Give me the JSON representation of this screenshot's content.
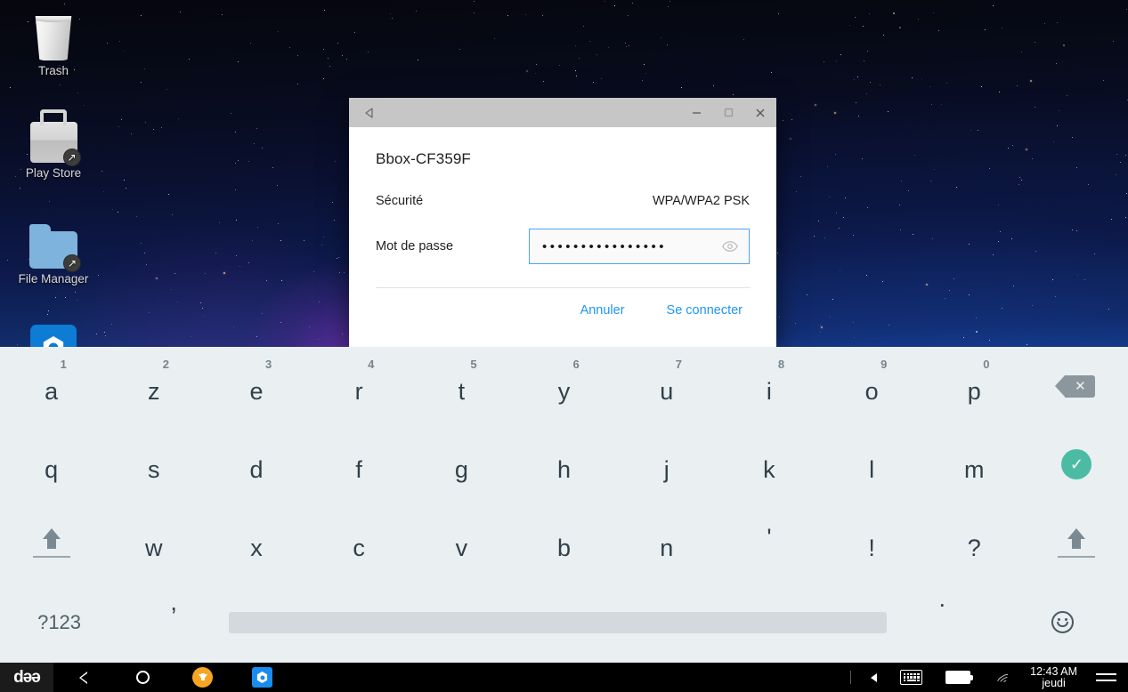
{
  "desktop": {
    "icons": [
      {
        "label": "Trash",
        "icon": "trash-icon"
      },
      {
        "label": "Play Store",
        "icon": "play-store-icon"
      },
      {
        "label": "File Manager",
        "icon": "folder-icon"
      },
      {
        "label": "",
        "icon": "settings-icon"
      }
    ]
  },
  "dialog": {
    "titlebar": {
      "back_icon": "back-triangle-icon",
      "minimize_label": "—",
      "maximize_label": "□",
      "close_label": "✕"
    },
    "ssid": "Bbox-CF359F",
    "security_label": "Sécurité",
    "security_value": "WPA/WPA2 PSK",
    "password_label": "Mot de passe",
    "password_masked": "••••••••••••••••",
    "password_placeholder": "Mot de passe",
    "reveal_icon": "eye-icon",
    "cancel_label": "Annuler",
    "connect_label": "Se connecter",
    "accent_color": "#2196f3",
    "field_border_color": "#4ea4f0"
  },
  "keyboard": {
    "row1": [
      {
        "ch": "a",
        "num": "1"
      },
      {
        "ch": "z",
        "num": "2"
      },
      {
        "ch": "e",
        "num": "3"
      },
      {
        "ch": "r",
        "num": "4"
      },
      {
        "ch": "t",
        "num": "5"
      },
      {
        "ch": "y",
        "num": "6"
      },
      {
        "ch": "u",
        "num": "7"
      },
      {
        "ch": "i",
        "num": "8"
      },
      {
        "ch": "o",
        "num": "9"
      },
      {
        "ch": "p",
        "num": "0"
      }
    ],
    "row1_action": "backspace-key",
    "row2": [
      "q",
      "s",
      "d",
      "f",
      "g",
      "h",
      "j",
      "k",
      "l",
      "m"
    ],
    "row2_action": "enter-key",
    "row3": [
      "w",
      "x",
      "c",
      "v",
      "b",
      "n",
      "'",
      "!",
      "?"
    ],
    "row3_shift_left": "shift-key-left",
    "row3_shift_right": "shift-key-right",
    "row4": {
      "symbols_label": "?123",
      "comma_label": ",",
      "space_label": "",
      "period_label": ".",
      "emoji_label": "emoji-key"
    },
    "bg_color": "#eaeff1",
    "key_text_color": "#30404a",
    "enter_color": "#4cbba4"
  },
  "taskbar": {
    "logo_label": "dǝə",
    "nav": [
      {
        "name": "back-button",
        "icon": "chevron-left-icon"
      },
      {
        "name": "home-button",
        "icon": "circle-icon"
      },
      {
        "name": "download-button",
        "icon": "download-arrow-icon"
      },
      {
        "name": "settings-button",
        "icon": "settings-icon"
      }
    ],
    "right": [
      {
        "name": "collapse-button",
        "icon": "left-triangle-icon"
      },
      {
        "name": "keyboard-button",
        "icon": "keyboard-icon"
      },
      {
        "name": "battery-status",
        "icon": "battery-icon"
      },
      {
        "name": "wifi-status",
        "icon": "wifi-icon"
      }
    ],
    "time": "12:43 AM",
    "day": "jeudi",
    "menu_icon": "hamburger-menu-icon"
  }
}
